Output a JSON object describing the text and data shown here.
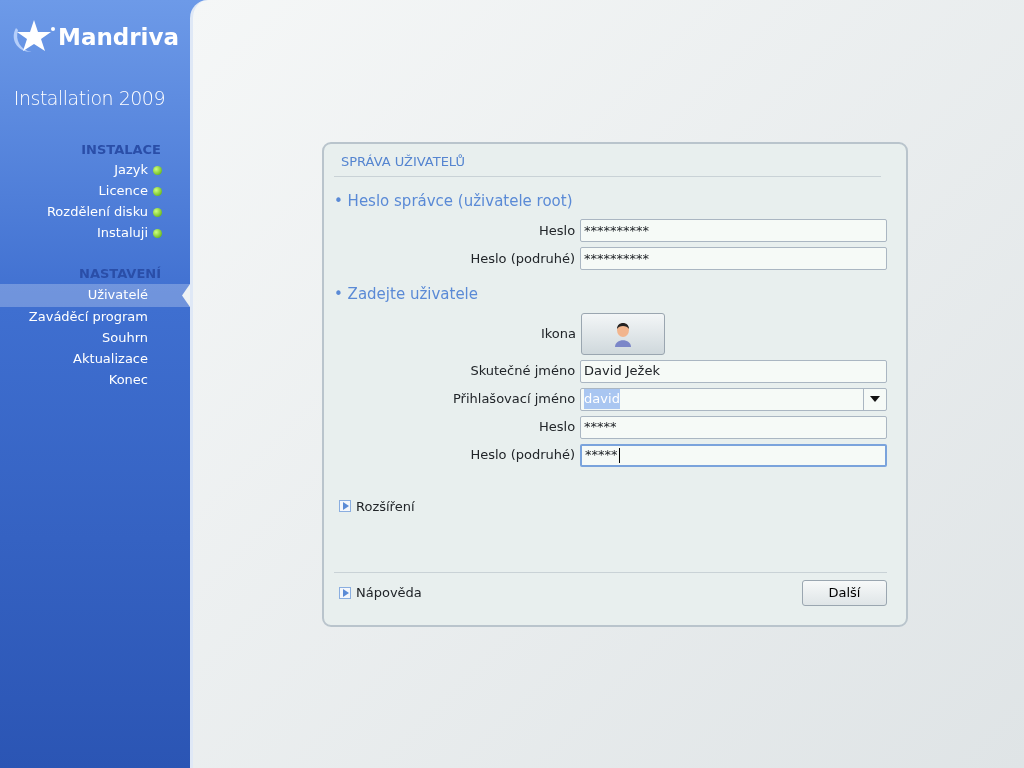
{
  "sidebar": {
    "logo": "Mandriva",
    "subtitle": "Installation 2009",
    "sections": [
      {
        "title": "INSTALACE",
        "items": [
          {
            "label": "Jazyk",
            "done": true,
            "selected": false
          },
          {
            "label": "Licence",
            "done": true,
            "selected": false
          },
          {
            "label": "Rozdělení disku",
            "done": true,
            "selected": false
          },
          {
            "label": "Instaluji",
            "done": true,
            "selected": false
          }
        ]
      },
      {
        "title": "NASTAVENÍ",
        "items": [
          {
            "label": "Uživatelé",
            "done": false,
            "selected": true
          },
          {
            "label": "Zaváděcí program",
            "done": false,
            "selected": false
          },
          {
            "label": "Souhrn",
            "done": false,
            "selected": false
          },
          {
            "label": "Aktualizace",
            "done": false,
            "selected": false
          },
          {
            "label": "Konec",
            "done": false,
            "selected": false
          }
        ]
      }
    ]
  },
  "panel": {
    "title": "SPRÁVA UŽIVATELŮ",
    "sections": [
      {
        "title": "• Heslo správce (uživatele root)",
        "fields": [
          {
            "kind": "password",
            "label": "Heslo",
            "value": "**********",
            "focused": false
          },
          {
            "kind": "password",
            "label": "Heslo (podruhé)",
            "value": "**********",
            "focused": false
          }
        ]
      },
      {
        "title": "• Zadejte uživatele",
        "fields": [
          {
            "kind": "icon",
            "label": "Ikona"
          },
          {
            "kind": "text",
            "label": "Skutečné jméno",
            "value": "David Ježek",
            "focused": false
          },
          {
            "kind": "combo",
            "label": "Přihlašovací jméno",
            "value": "david",
            "focused": false,
            "text_selected": true
          },
          {
            "kind": "password",
            "label": "Heslo",
            "value": "*****",
            "focused": false
          },
          {
            "kind": "password",
            "label": "Heslo (podruhé)",
            "value": "*****",
            "focused": true
          }
        ]
      }
    ],
    "advanced": {
      "label": "Rozšíření",
      "expanded": false
    },
    "help": {
      "label": "Nápověda",
      "expanded": false
    },
    "next_button": "Další"
  }
}
